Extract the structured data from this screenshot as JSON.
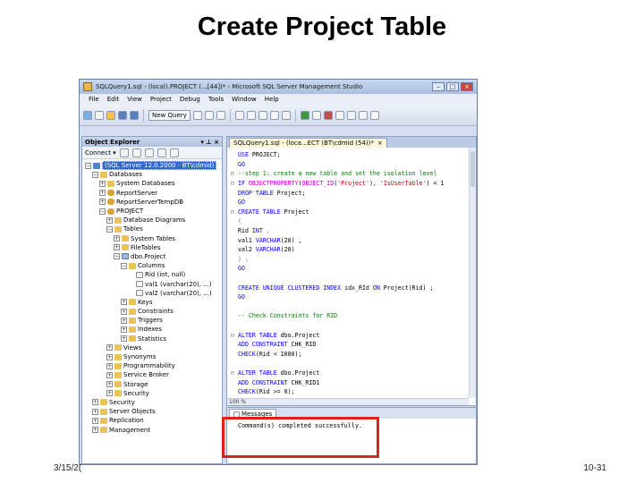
{
  "slide": {
    "title": "Create Project Table",
    "footer_left": "3/15/2(",
    "footer_right": "10-31"
  },
  "window": {
    "title": "SQLQuery1.sql - (local).PROJECT (...[44])* - Microsoft SQL Server Management Studio"
  },
  "menu": [
    "File",
    "Edit",
    "View",
    "Project",
    "Debug",
    "Tools",
    "Window",
    "Help"
  ],
  "toolbar": {
    "new_query_label": "New Query"
  },
  "object_explorer": {
    "header": "Object Explorer",
    "connect_label": "Connect ▾",
    "tree": [
      {
        "depth": 0,
        "exp": "-",
        "icon": "server",
        "label": "(SQL Server 12.0.2000 - BT\\cdmid)",
        "selected": true
      },
      {
        "depth": 1,
        "exp": "-",
        "icon": "folder",
        "label": "Databases"
      },
      {
        "depth": 2,
        "exp": "+",
        "icon": "folder",
        "label": "System Databases"
      },
      {
        "depth": 2,
        "exp": "+",
        "icon": "db",
        "label": "ReportServer"
      },
      {
        "depth": 2,
        "exp": "+",
        "icon": "db",
        "label": "ReportServerTempDB"
      },
      {
        "depth": 2,
        "exp": "-",
        "icon": "db",
        "label": "PROJECT"
      },
      {
        "depth": 3,
        "exp": "+",
        "icon": "folder",
        "label": "Database Diagrams"
      },
      {
        "depth": 3,
        "exp": "-",
        "icon": "folder",
        "label": "Tables"
      },
      {
        "depth": 4,
        "exp": "+",
        "icon": "folder",
        "label": "System Tables"
      },
      {
        "depth": 4,
        "exp": "+",
        "icon": "folder",
        "label": "FileTables"
      },
      {
        "depth": 4,
        "exp": "-",
        "icon": "table",
        "label": "dbo.Project"
      },
      {
        "depth": 5,
        "exp": "-",
        "icon": "folder",
        "label": "Columns"
      },
      {
        "depth": 6,
        "exp": "",
        "icon": "column",
        "label": "Rid (int, null)"
      },
      {
        "depth": 6,
        "exp": "",
        "icon": "column",
        "label": "val1 (varchar(20), ...)"
      },
      {
        "depth": 6,
        "exp": "",
        "icon": "column",
        "label": "val2 (varchar(20), ...)"
      },
      {
        "depth": 5,
        "exp": "+",
        "icon": "folder",
        "label": "Keys"
      },
      {
        "depth": 5,
        "exp": "+",
        "icon": "folder",
        "label": "Constraints"
      },
      {
        "depth": 5,
        "exp": "+",
        "icon": "folder",
        "label": "Triggers"
      },
      {
        "depth": 5,
        "exp": "+",
        "icon": "folder",
        "label": "Indexes"
      },
      {
        "depth": 5,
        "exp": "+",
        "icon": "folder",
        "label": "Statistics"
      },
      {
        "depth": 3,
        "exp": "+",
        "icon": "folder",
        "label": "Views"
      },
      {
        "depth": 3,
        "exp": "+",
        "icon": "folder",
        "label": "Synonyms"
      },
      {
        "depth": 3,
        "exp": "+",
        "icon": "folder",
        "label": "Programmability"
      },
      {
        "depth": 3,
        "exp": "+",
        "icon": "folder",
        "label": "Service Broker"
      },
      {
        "depth": 3,
        "exp": "+",
        "icon": "folder",
        "label": "Storage"
      },
      {
        "depth": 3,
        "exp": "+",
        "icon": "folder",
        "label": "Security"
      },
      {
        "depth": 1,
        "exp": "+",
        "icon": "folder",
        "label": "Security"
      },
      {
        "depth": 1,
        "exp": "+",
        "icon": "folder",
        "label": "Server Objects"
      },
      {
        "depth": 1,
        "exp": "+",
        "icon": "folder",
        "label": "Replication"
      },
      {
        "depth": 1,
        "exp": "+",
        "icon": "folder",
        "label": "Management"
      }
    ]
  },
  "editor": {
    "tab_label": "SQLQuery1.sql - (loca...ECT (BT\\cdmid (54))*",
    "lines": [
      {
        "g": "",
        "parts": [
          [
            "kw",
            "USE "
          ],
          [
            "",
            "PROJECT;"
          ]
        ]
      },
      {
        "g": "",
        "parts": [
          [
            "kw",
            "GO"
          ]
        ]
      },
      {
        "g": "-",
        "parts": [
          [
            "cm",
            "--step 1: create a new table and set the isolation level"
          ]
        ]
      },
      {
        "g": "-",
        "parts": [
          [
            "kw",
            "IF "
          ],
          [
            "fn",
            "OBJECTPROPERTY"
          ],
          [
            "",
            "("
          ],
          [
            "fn",
            "OBJECT_ID"
          ],
          [
            "",
            "("
          ],
          [
            "str",
            "'Project'"
          ],
          [
            "",
            "), "
          ],
          [
            "str",
            "'IsUserTable'"
          ],
          [
            "",
            ") = 1"
          ]
        ]
      },
      {
        "g": "",
        "parts": [
          [
            "kw",
            "DROP TABLE "
          ],
          [
            "",
            "Project;"
          ]
        ]
      },
      {
        "g": "",
        "parts": [
          [
            "kw",
            "GO"
          ]
        ]
      },
      {
        "g": "-",
        "parts": [
          [
            "kw",
            "CREATE TABLE "
          ],
          [
            "",
            "Project"
          ]
        ]
      },
      {
        "g": "",
        "parts": [
          [
            "gr",
            "("
          ]
        ]
      },
      {
        "g": "",
        "parts": [
          [
            "",
            "Rid "
          ],
          [
            "kw",
            "INT"
          ],
          [
            "gr",
            " ,"
          ]
        ]
      },
      {
        "g": "",
        "parts": [
          [
            "",
            "val1 "
          ],
          [
            "kw",
            "VARCHAR"
          ],
          [
            "",
            "(20) ,"
          ]
        ]
      },
      {
        "g": "",
        "parts": [
          [
            "",
            "val2 "
          ],
          [
            "kw",
            "VARCHAR"
          ],
          [
            "",
            "(20)"
          ]
        ]
      },
      {
        "g": "",
        "parts": [
          [
            "gr",
            ") ;"
          ]
        ]
      },
      {
        "g": "",
        "parts": [
          [
            "kw",
            "GO"
          ]
        ]
      },
      {
        "g": "",
        "parts": [
          [
            "",
            ""
          ]
        ]
      },
      {
        "g": "",
        "parts": [
          [
            "kw",
            "CREATE UNIQUE CLUSTERED INDEX "
          ],
          [
            "",
            "idx_RId "
          ],
          [
            "kw",
            "ON "
          ],
          [
            "",
            "Project(Rid) ;"
          ]
        ]
      },
      {
        "g": "",
        "parts": [
          [
            "kw",
            "GO"
          ]
        ]
      },
      {
        "g": "",
        "parts": [
          [
            "",
            ""
          ]
        ]
      },
      {
        "g": "",
        "parts": [
          [
            "cm",
            "-- Check Constraints for RID"
          ]
        ]
      },
      {
        "g": "",
        "parts": [
          [
            "",
            ""
          ]
        ]
      },
      {
        "g": "-",
        "parts": [
          [
            "kw",
            "ALTER TABLE "
          ],
          [
            "",
            "dbo.Project"
          ]
        ]
      },
      {
        "g": "",
        "parts": [
          [
            "kw",
            "ADD CONSTRAINT "
          ],
          [
            "",
            "CHK_RID"
          ]
        ]
      },
      {
        "g": "",
        "parts": [
          [
            "kw",
            "CHECK"
          ],
          [
            "",
            "(Rid < 1000);"
          ]
        ]
      },
      {
        "g": "",
        "parts": [
          [
            "",
            ""
          ]
        ]
      },
      {
        "g": "-",
        "parts": [
          [
            "kw",
            "ALTER TABLE "
          ],
          [
            "",
            "dbo.Project"
          ]
        ]
      },
      {
        "g": "",
        "parts": [
          [
            "kw",
            "ADD CONSTRAINT "
          ],
          [
            "",
            "CHK_RID1"
          ]
        ]
      },
      {
        "g": "",
        "parts": [
          [
            "kw",
            "CHECK"
          ],
          [
            "",
            "(Rid >= 0);"
          ]
        ]
      }
    ],
    "zoom": "100 %"
  },
  "messages": {
    "tab_label": "Messages",
    "text": "Command(s) completed successfully."
  }
}
